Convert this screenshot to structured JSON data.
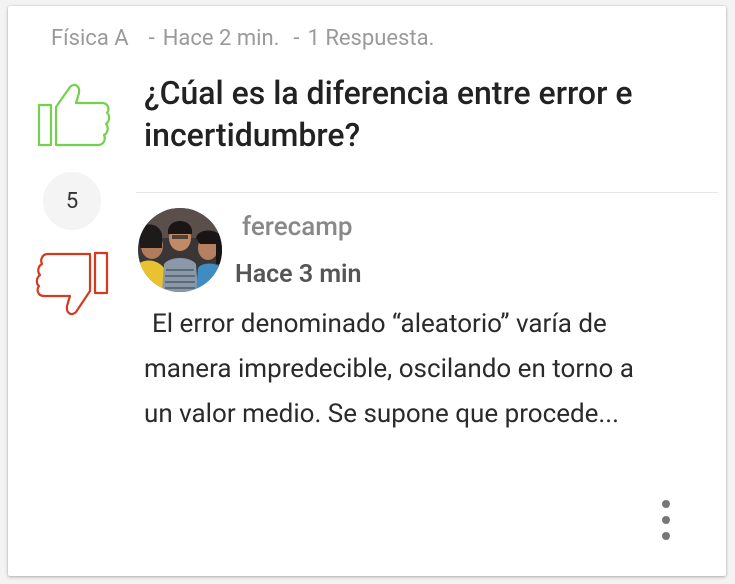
{
  "meta": {
    "subject": "Física A",
    "separator": "-",
    "posted": "Hace 2 min.",
    "responses": "1 Respuesta."
  },
  "question": {
    "title": "¿Cúal es la diferencia entre error e incertidumbre?",
    "votes": "5"
  },
  "answer": {
    "username": "ferecamp",
    "time": "Hace 3 min",
    "lines": [
      "El error denominado “aleatorio” varía de",
      "manera impredecible, oscilando en torno a",
      "un valor medio. Se supone que procede..."
    ]
  },
  "icons": {
    "upvote": "thumbs-up-icon",
    "downvote": "thumbs-down-icon",
    "more": "more-vertical-icon"
  },
  "colors": {
    "upvote": "#74d14c",
    "downvote": "#d33a1e",
    "text": "#222222",
    "muted": "#9a9a9a"
  }
}
